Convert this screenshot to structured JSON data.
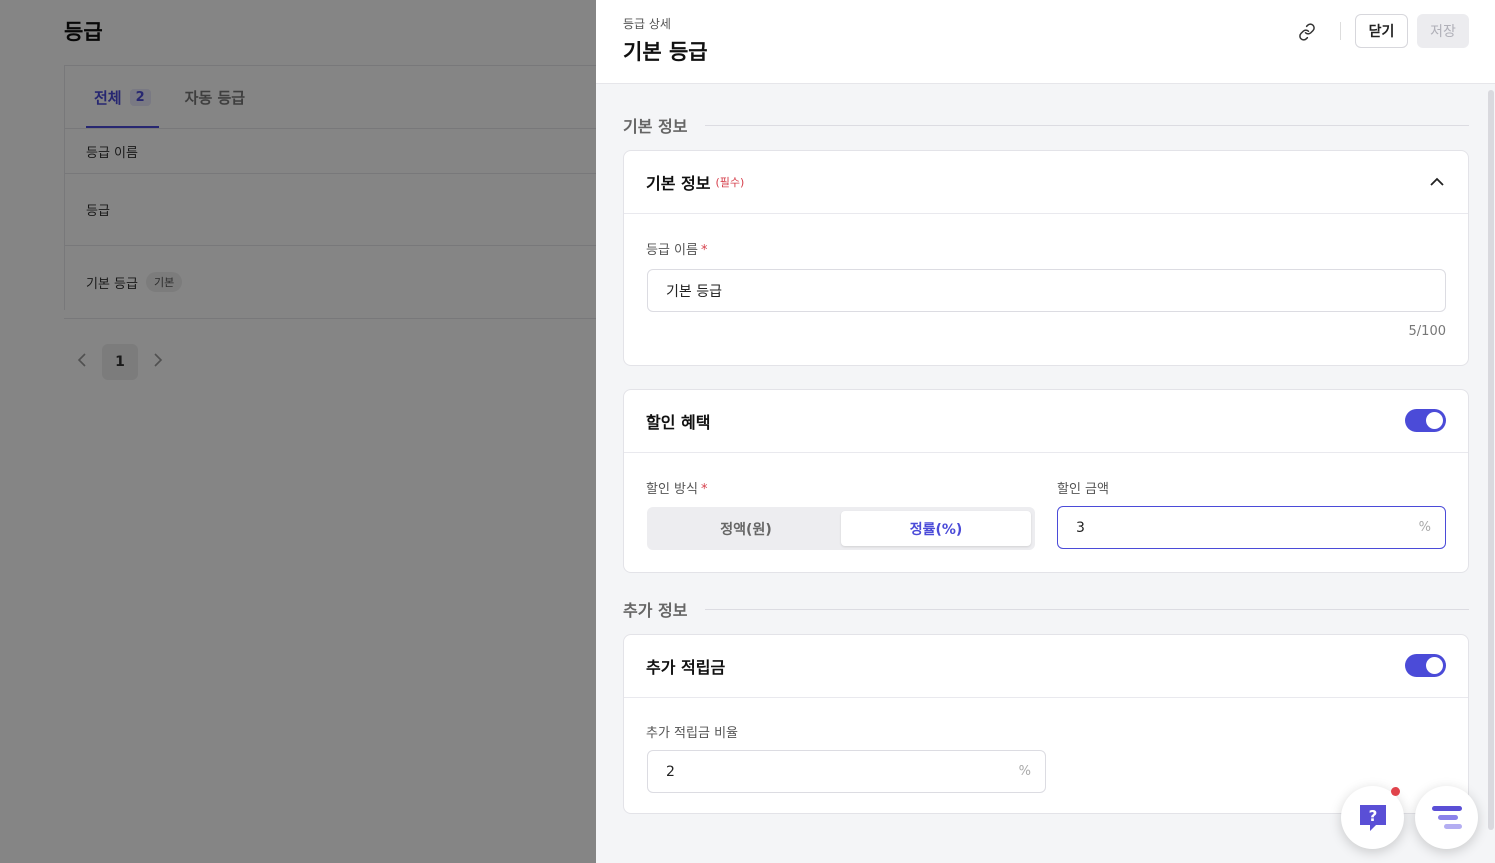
{
  "background": {
    "page_title": "등급",
    "tabs": [
      {
        "label": "전체",
        "count": "2"
      },
      {
        "label": "자동 등급"
      }
    ],
    "table_header": "등급 이름",
    "rows": [
      {
        "name": "등급"
      },
      {
        "name": "기본 등급",
        "badge": "기본"
      }
    ],
    "pagination": {
      "current": "1"
    }
  },
  "drawer": {
    "subtitle": "등급 상세",
    "title": "기본 등급",
    "close_label": "닫기",
    "save_label": "저장",
    "section_basic": "기본 정보",
    "basic_card": {
      "title": "기본 정보",
      "required_tag": "(필수)",
      "name_label": "등급 이름",
      "name_value": "기본 등급",
      "name_counter": "5/100"
    },
    "discount_card": {
      "title": "할인 혜택",
      "toggle_on": true,
      "method_label": "할인 방식",
      "method_options": [
        "정액(원)",
        "정률(%)"
      ],
      "method_selected": "정률(%)",
      "amount_label": "할인 금액",
      "amount_value": "3",
      "amount_unit": "%"
    },
    "section_extra": "추가 정보",
    "points_card": {
      "title": "추가 적립금",
      "toggle_on": true,
      "rate_label": "추가 적립금 비율",
      "rate_value": "2",
      "rate_unit": "%"
    }
  },
  "colors": {
    "accent": "#4b4bd8",
    "required": "#d6404c"
  }
}
